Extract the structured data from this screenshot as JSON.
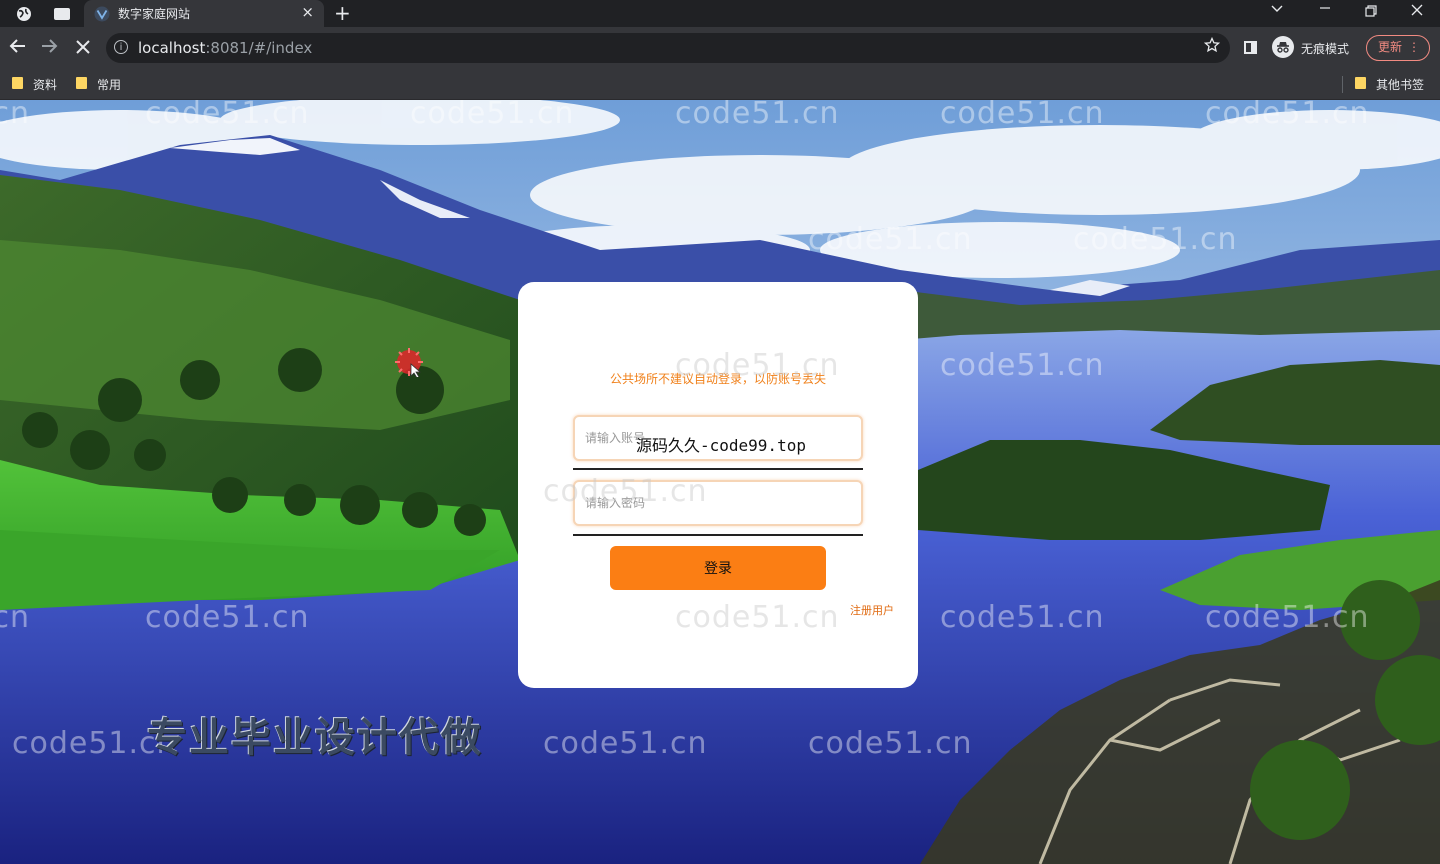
{
  "browser": {
    "tab_title": "数字家庭网站",
    "tab_close": "×",
    "new_tab": "+",
    "url_host": "localhost",
    "url_rest": ":8081/#/index",
    "incognito_label": "无痕模式",
    "update_label": "更新",
    "bookmarks": [
      "资料",
      "常用"
    ],
    "other_bookmarks": "其他书签"
  },
  "login": {
    "notice": "公共场所不建议自动登录，以防账号丢失",
    "username_placeholder": "请输入账号",
    "password_placeholder": "请输入密码",
    "login_button": "登录",
    "register_link": "注册用户",
    "overlay_text": "源码久久-code99.top"
  },
  "overlays": {
    "promo_text": "专业毕业设计代做",
    "watermark": "code51.cn"
  },
  "colors": {
    "accent": "#fb7e14",
    "notice": "#f0811b",
    "chrome_dark": "#202124",
    "chrome": "#35363a"
  }
}
